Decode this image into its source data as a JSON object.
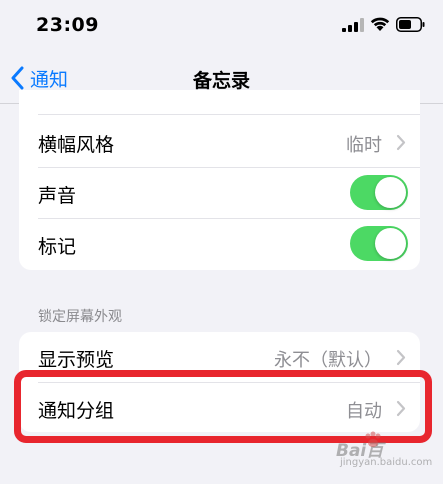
{
  "status_bar": {
    "time": "23:09",
    "icons": [
      "signal-icon",
      "wifi-icon",
      "battery-icon"
    ]
  },
  "nav": {
    "back_label": "通知",
    "title": "备忘录"
  },
  "group1": {
    "rows": [
      {
        "label": "横幅风格",
        "value": "临时",
        "control": "chevron"
      },
      {
        "label": "声音",
        "control": "toggle",
        "on": true
      },
      {
        "label": "标记",
        "control": "toggle",
        "on": true
      }
    ]
  },
  "lock_screen": {
    "header": "锁定屏幕外观",
    "rows": [
      {
        "label": "显示预览",
        "value": "永不（默认）"
      },
      {
        "label": "通知分组",
        "value": "自动"
      }
    ]
  },
  "colors": {
    "accent": "#0a7aff",
    "toggle_on": "#4cd964",
    "highlight": "#e8262e",
    "background": "#f2f2f7"
  },
  "watermark": {
    "text": "Bai",
    "text2": "百",
    "sub": "jingyan.baidu.com"
  }
}
